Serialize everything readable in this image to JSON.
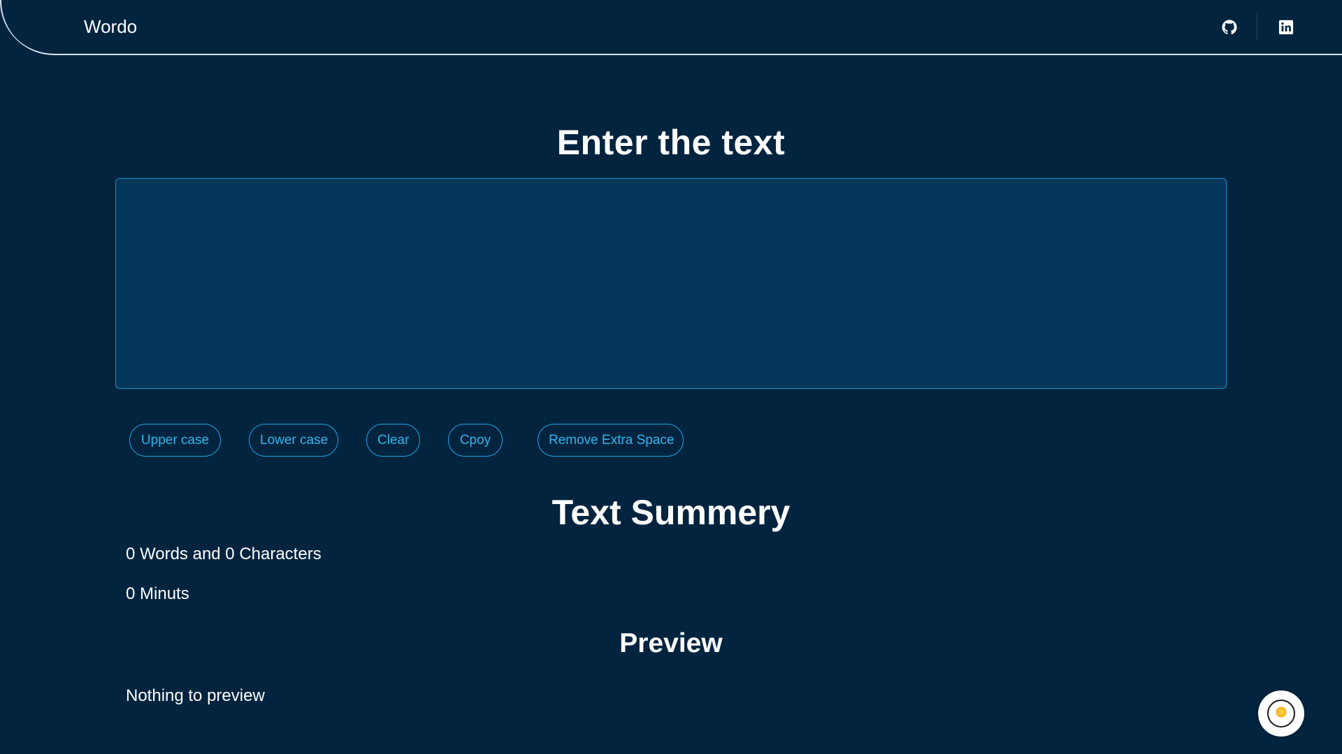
{
  "navbar": {
    "brand": "Wordo",
    "github_icon": "github-icon",
    "linkedin_icon": "linkedin-icon"
  },
  "main": {
    "title": "Enter the text",
    "textarea": {
      "value": "",
      "placeholder": ""
    },
    "buttons": {
      "upper": "Upper case",
      "lower": "Lower case",
      "clear": "Clear",
      "copy": "Cpoy",
      "remove_space": "Remove Extra Space"
    }
  },
  "summary": {
    "title": "Text Summery",
    "words_line": "0 Words and 0 Characters",
    "minutes_line": "0 Minuts"
  },
  "preview": {
    "title": "Preview",
    "text": "Nothing to preview"
  },
  "theme_toggle": {
    "icon": "sun-icon"
  },
  "colors": {
    "background": "#03243f",
    "textarea_bg": "#05375a",
    "accent": "#1aa6e3",
    "sun": "#f7b21b"
  }
}
